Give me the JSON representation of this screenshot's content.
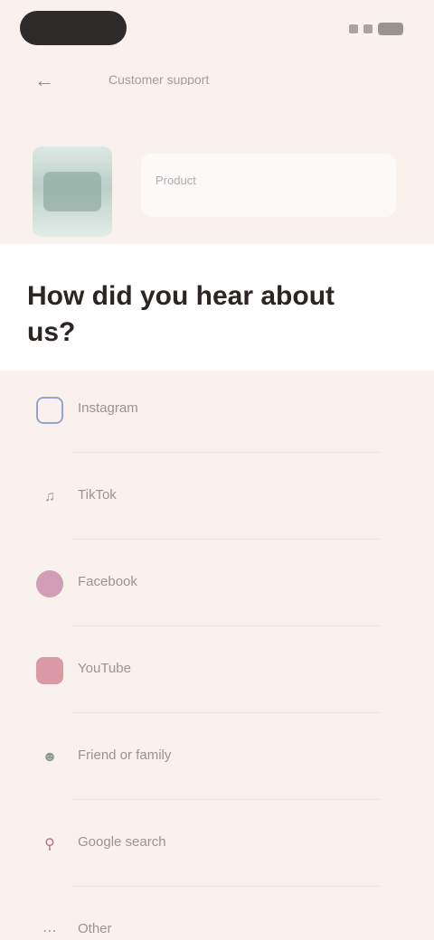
{
  "status_bar": {
    "icons": [
      "signal-icon",
      "wifi-icon",
      "battery-icon"
    ]
  },
  "top_bar": {
    "back_icon": "back-arrow-icon",
    "title": "Customer support"
  },
  "product": {
    "name": "Product"
  },
  "question": "How did you hear about us?",
  "options": [
    {
      "label": "Instagram",
      "icon": "instagram-icon",
      "color": "#5b6fb8"
    },
    {
      "label": "TikTok",
      "icon": "tiktok-icon",
      "color": "#9e9896"
    },
    {
      "label": "Facebook",
      "icon": "facebook-icon",
      "color": "#b05a86"
    },
    {
      "label": "YouTube",
      "icon": "youtube-icon",
      "color": "#c0506a"
    },
    {
      "label": "Friend or family",
      "icon": "people-icon",
      "color": "#8e9a94"
    },
    {
      "label": "Google search",
      "icon": "search-icon",
      "color": "#b87080"
    },
    {
      "label": "Other",
      "icon": "more-icon",
      "color": "#a9a3a1"
    }
  ]
}
